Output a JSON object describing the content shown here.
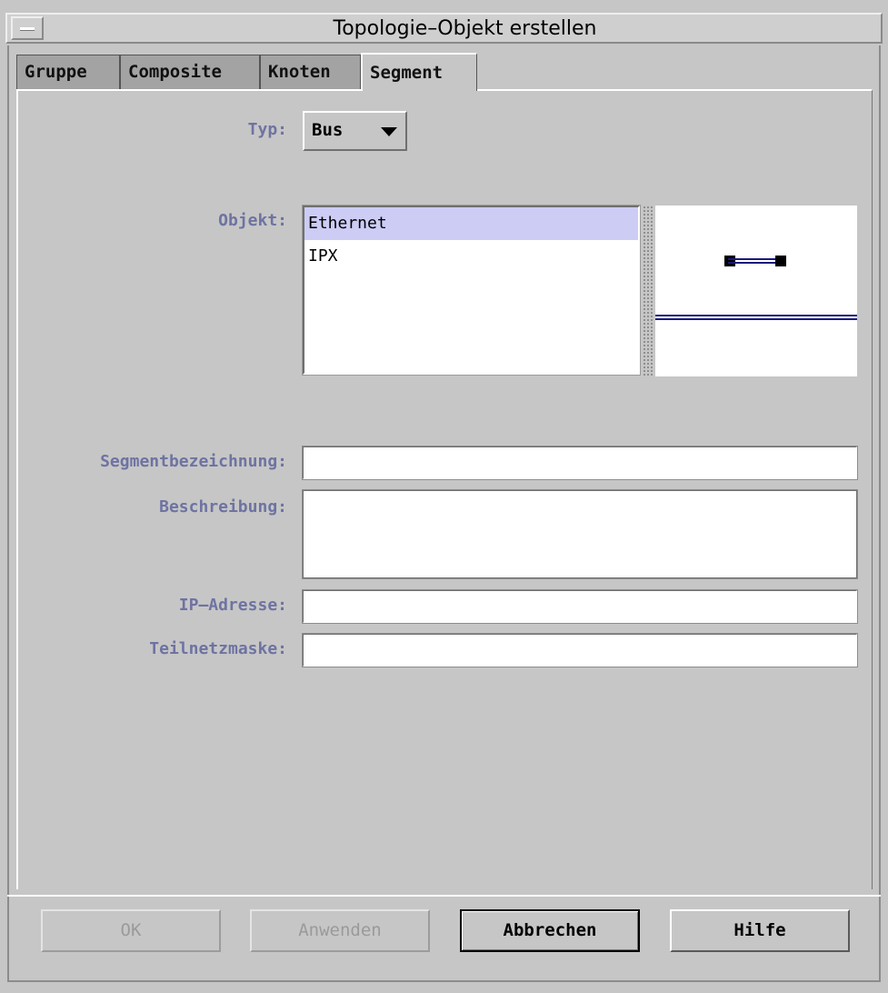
{
  "window": {
    "title": "Topologie–Objekt erstellen"
  },
  "tabs": [
    {
      "label": "Gruppe",
      "active": false
    },
    {
      "label": "Composite",
      "active": false
    },
    {
      "label": "Knoten",
      "active": false
    },
    {
      "label": "Segment",
      "active": true
    }
  ],
  "form": {
    "type_label": "Typ:",
    "type_value": "Bus",
    "object_label": "Objekt:",
    "objects": [
      {
        "label": "Ethernet",
        "selected": true
      },
      {
        "label": "IPX",
        "selected": false
      }
    ],
    "segment_name_label": "Segmentbezeichnung:",
    "segment_name_value": "",
    "description_label": "Beschreibung:",
    "description_value": "",
    "ip_label": "IP–Adresse:",
    "ip_value": "",
    "subnet_label": "Teilnetzmaske:",
    "subnet_value": ""
  },
  "buttons": {
    "ok": "OK",
    "apply": "Anwenden",
    "cancel": "Abbrechen",
    "help": "Hilfe"
  },
  "colors": {
    "label": "#6e73a2",
    "selection": "#ccccf5",
    "background": "#c6c6c6",
    "preview_line": "#1a1a7a"
  },
  "icons": {
    "window_menu": "window-menu-icon",
    "dropdown": "chevron-down-icon",
    "preview": "bus-segment-preview-icon"
  }
}
